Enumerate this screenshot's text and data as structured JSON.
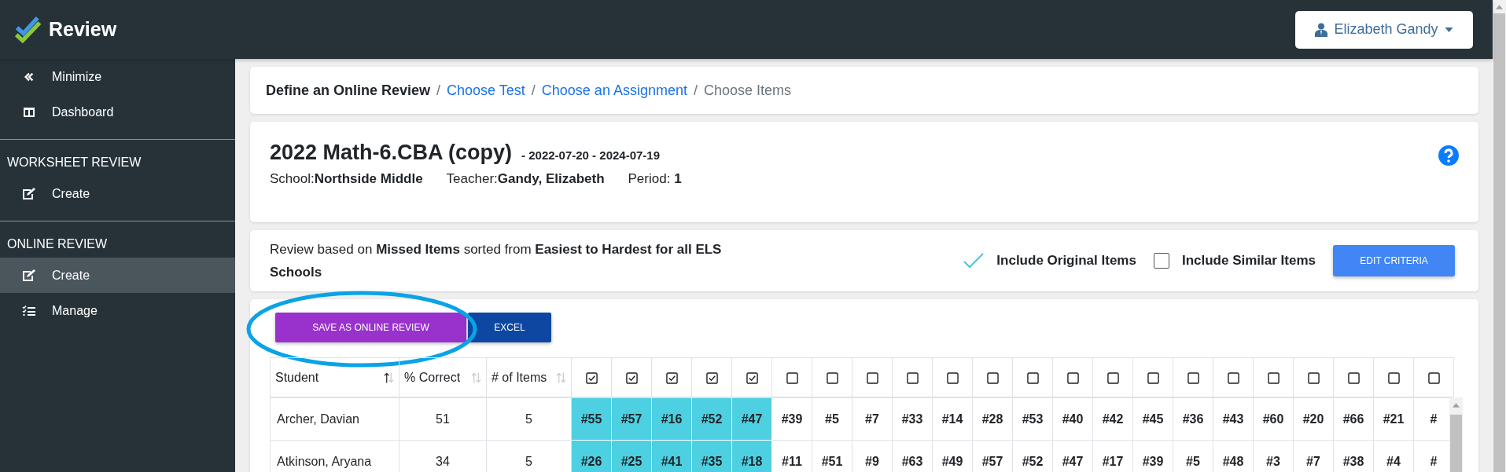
{
  "app": {
    "title": "Review"
  },
  "user_menu": {
    "name": "Elizabeth Gandy"
  },
  "sidebar": {
    "top": [
      {
        "label": "Minimize",
        "selected": false
      },
      {
        "label": "Dashboard",
        "selected": false
      }
    ],
    "sections": [
      {
        "heading": "WORKSHEET REVIEW",
        "items": [
          {
            "label": "Create",
            "selected": false
          }
        ]
      },
      {
        "heading": "ONLINE REVIEW",
        "items": [
          {
            "label": "Create",
            "selected": true
          },
          {
            "label": "Manage",
            "selected": false
          }
        ]
      }
    ]
  },
  "breadcrumb": [
    {
      "label": "Define an Online Review",
      "kind": "title"
    },
    {
      "separator": "/",
      "label": "Choose Test",
      "kind": "link"
    },
    {
      "separator": "/",
      "label": "Choose an Assignment",
      "kind": "link"
    },
    {
      "separator": "/",
      "label": "Choose Items",
      "kind": "text"
    }
  ],
  "header": {
    "title": "2022 Math-6.CBA (copy)",
    "dates": "- 2022-07-20 - 2024-07-19",
    "meta": [
      "School:**Northside Middle**",
      "Teacher:**Gandy, Elizabeth**",
      "Period: **1**"
    ]
  },
  "criteria": {
    "text": "Review based on **Missed Items** sorted from **Easiest to Hardest for all ELS Schools**",
    "options": [
      {
        "label": "Include Original Items",
        "checked": true
      },
      {
        "label": "Include Similar Items",
        "checked": false
      }
    ],
    "button": "EDIT CRITERIA"
  },
  "actions": [
    {
      "label": "SAVE AS ONLINE REVIEW",
      "kind": "primary"
    },
    {
      "label": "EXCEL",
      "kind": "secondary"
    }
  ],
  "table": {
    "columns": [
      {
        "label": "Student",
        "sorted": true
      },
      {
        "label": "% Correct",
        "sorted": false
      },
      {
        "label": "# of Items",
        "sorted": false
      }
    ],
    "item_columns": [
      {
        "checked": true
      },
      {
        "checked": true
      },
      {
        "checked": true
      },
      {
        "checked": true
      },
      {
        "checked": true
      },
      {
        "checked": false
      },
      {
        "checked": false
      },
      {
        "checked": false
      },
      {
        "checked": false
      },
      {
        "checked": false
      },
      {
        "checked": false
      },
      {
        "checked": false
      },
      {
        "checked": false
      },
      {
        "checked": false
      },
      {
        "checked": false
      },
      {
        "checked": false
      },
      {
        "checked": false
      },
      {
        "checked": false
      },
      {
        "checked": false
      },
      {
        "checked": false
      },
      {
        "checked": false
      },
      {
        "checked": false
      }
    ],
    "rows": [
      {
        "student": "Archer, Davian",
        "percent": "51",
        "count": "5",
        "items": [
          "#55",
          "#57",
          "#16",
          "#52",
          "#47",
          "#39",
          "#5",
          "#7",
          "#33",
          "#14",
          "#28",
          "#53",
          "#40",
          "#42",
          "#45",
          "#36",
          "#43",
          "#60",
          "#20",
          "#66",
          "#21",
          "#"
        ]
      },
      {
        "student": "Atkinson, Aryana",
        "percent": "34",
        "count": "5",
        "items": [
          "#26",
          "#25",
          "#41",
          "#35",
          "#18",
          "#11",
          "#51",
          "#9",
          "#63",
          "#49",
          "#57",
          "#52",
          "#47",
          "#17",
          "#39",
          "#5",
          "#48",
          "#3",
          "#7",
          "#38",
          "#4",
          "#"
        ]
      }
    ]
  }
}
